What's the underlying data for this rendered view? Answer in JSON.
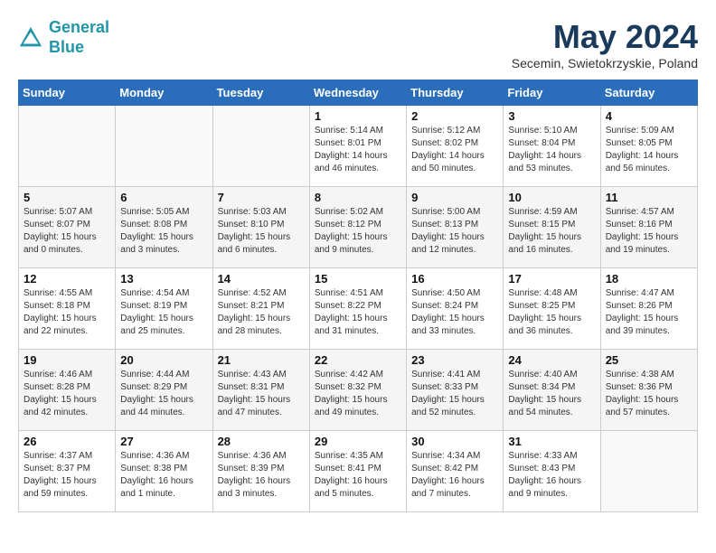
{
  "header": {
    "logo_line1": "General",
    "logo_line2": "Blue",
    "month_title": "May 2024",
    "location": "Secemin, Swietokrzyskie, Poland"
  },
  "weekdays": [
    "Sunday",
    "Monday",
    "Tuesday",
    "Wednesday",
    "Thursday",
    "Friday",
    "Saturday"
  ],
  "weeks": [
    [
      {
        "day": "",
        "info": ""
      },
      {
        "day": "",
        "info": ""
      },
      {
        "day": "",
        "info": ""
      },
      {
        "day": "1",
        "info": "Sunrise: 5:14 AM\nSunset: 8:01 PM\nDaylight: 14 hours\nand 46 minutes."
      },
      {
        "day": "2",
        "info": "Sunrise: 5:12 AM\nSunset: 8:02 PM\nDaylight: 14 hours\nand 50 minutes."
      },
      {
        "day": "3",
        "info": "Sunrise: 5:10 AM\nSunset: 8:04 PM\nDaylight: 14 hours\nand 53 minutes."
      },
      {
        "day": "4",
        "info": "Sunrise: 5:09 AM\nSunset: 8:05 PM\nDaylight: 14 hours\nand 56 minutes."
      }
    ],
    [
      {
        "day": "5",
        "info": "Sunrise: 5:07 AM\nSunset: 8:07 PM\nDaylight: 15 hours\nand 0 minutes."
      },
      {
        "day": "6",
        "info": "Sunrise: 5:05 AM\nSunset: 8:08 PM\nDaylight: 15 hours\nand 3 minutes."
      },
      {
        "day": "7",
        "info": "Sunrise: 5:03 AM\nSunset: 8:10 PM\nDaylight: 15 hours\nand 6 minutes."
      },
      {
        "day": "8",
        "info": "Sunrise: 5:02 AM\nSunset: 8:12 PM\nDaylight: 15 hours\nand 9 minutes."
      },
      {
        "day": "9",
        "info": "Sunrise: 5:00 AM\nSunset: 8:13 PM\nDaylight: 15 hours\nand 12 minutes."
      },
      {
        "day": "10",
        "info": "Sunrise: 4:59 AM\nSunset: 8:15 PM\nDaylight: 15 hours\nand 16 minutes."
      },
      {
        "day": "11",
        "info": "Sunrise: 4:57 AM\nSunset: 8:16 PM\nDaylight: 15 hours\nand 19 minutes."
      }
    ],
    [
      {
        "day": "12",
        "info": "Sunrise: 4:55 AM\nSunset: 8:18 PM\nDaylight: 15 hours\nand 22 minutes."
      },
      {
        "day": "13",
        "info": "Sunrise: 4:54 AM\nSunset: 8:19 PM\nDaylight: 15 hours\nand 25 minutes."
      },
      {
        "day": "14",
        "info": "Sunrise: 4:52 AM\nSunset: 8:21 PM\nDaylight: 15 hours\nand 28 minutes."
      },
      {
        "day": "15",
        "info": "Sunrise: 4:51 AM\nSunset: 8:22 PM\nDaylight: 15 hours\nand 31 minutes."
      },
      {
        "day": "16",
        "info": "Sunrise: 4:50 AM\nSunset: 8:24 PM\nDaylight: 15 hours\nand 33 minutes."
      },
      {
        "day": "17",
        "info": "Sunrise: 4:48 AM\nSunset: 8:25 PM\nDaylight: 15 hours\nand 36 minutes."
      },
      {
        "day": "18",
        "info": "Sunrise: 4:47 AM\nSunset: 8:26 PM\nDaylight: 15 hours\nand 39 minutes."
      }
    ],
    [
      {
        "day": "19",
        "info": "Sunrise: 4:46 AM\nSunset: 8:28 PM\nDaylight: 15 hours\nand 42 minutes."
      },
      {
        "day": "20",
        "info": "Sunrise: 4:44 AM\nSunset: 8:29 PM\nDaylight: 15 hours\nand 44 minutes."
      },
      {
        "day": "21",
        "info": "Sunrise: 4:43 AM\nSunset: 8:31 PM\nDaylight: 15 hours\nand 47 minutes."
      },
      {
        "day": "22",
        "info": "Sunrise: 4:42 AM\nSunset: 8:32 PM\nDaylight: 15 hours\nand 49 minutes."
      },
      {
        "day": "23",
        "info": "Sunrise: 4:41 AM\nSunset: 8:33 PM\nDaylight: 15 hours\nand 52 minutes."
      },
      {
        "day": "24",
        "info": "Sunrise: 4:40 AM\nSunset: 8:34 PM\nDaylight: 15 hours\nand 54 minutes."
      },
      {
        "day": "25",
        "info": "Sunrise: 4:38 AM\nSunset: 8:36 PM\nDaylight: 15 hours\nand 57 minutes."
      }
    ],
    [
      {
        "day": "26",
        "info": "Sunrise: 4:37 AM\nSunset: 8:37 PM\nDaylight: 15 hours\nand 59 minutes."
      },
      {
        "day": "27",
        "info": "Sunrise: 4:36 AM\nSunset: 8:38 PM\nDaylight: 16 hours\nand 1 minute."
      },
      {
        "day": "28",
        "info": "Sunrise: 4:36 AM\nSunset: 8:39 PM\nDaylight: 16 hours\nand 3 minutes."
      },
      {
        "day": "29",
        "info": "Sunrise: 4:35 AM\nSunset: 8:41 PM\nDaylight: 16 hours\nand 5 minutes."
      },
      {
        "day": "30",
        "info": "Sunrise: 4:34 AM\nSunset: 8:42 PM\nDaylight: 16 hours\nand 7 minutes."
      },
      {
        "day": "31",
        "info": "Sunrise: 4:33 AM\nSunset: 8:43 PM\nDaylight: 16 hours\nand 9 minutes."
      },
      {
        "day": "",
        "info": ""
      }
    ]
  ]
}
